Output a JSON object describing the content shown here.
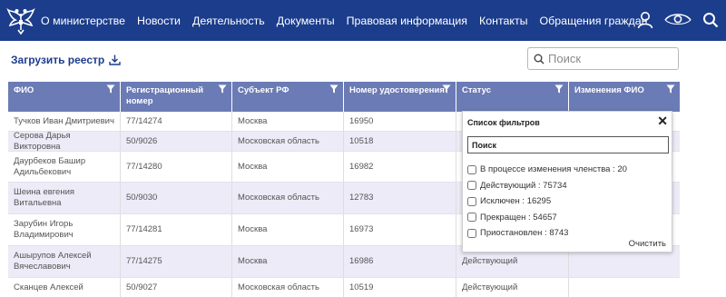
{
  "colors": {
    "header_bg": "#1c3d8c",
    "table_header_bg": "#6b7bb5",
    "row_alt_bg": "#ecebf7"
  },
  "nav": {
    "items": [
      "О министерстве",
      "Новости",
      "Деятельность",
      "Документы",
      "Правовая информация",
      "Контакты",
      "Обращения граждан"
    ],
    "icons": [
      "user-icon",
      "eye-icon",
      "search-icon"
    ]
  },
  "logo": {
    "icon": "double-headed-eagle-emblem"
  },
  "toolbar": {
    "upload_label": "Загрузить реестр",
    "upload_icon": "download-icon",
    "search_placeholder": "Поиск"
  },
  "table": {
    "headers": [
      "ФИО",
      "Регистрационный номер",
      "Субъект РФ",
      "Номер удостоверения",
      "Статус",
      "Изменения ФИО"
    ],
    "rows": [
      [
        "Тучков Иван Дмитриевич",
        "77/14274",
        "Москва",
        "16950",
        "",
        ""
      ],
      [
        "Серова Дарья Викторовна",
        "50/9026",
        "Московская область",
        "10518",
        "",
        ""
      ],
      [
        "Даурбеков Башир Адильбекович",
        "77/14280",
        "Москва",
        "16982",
        "",
        ""
      ],
      [
        "Шеина евгения Витальевна",
        "50/9030",
        "Московская область",
        "12783",
        "",
        ""
      ],
      [
        "Зарубин Игорь Владимирович",
        "77/14281",
        "Москва",
        "16973",
        "",
        ""
      ],
      [
        "Ашырупов Алексей Вячеславович",
        "77/14275",
        "Москва",
        "16986",
        "Действующий",
        ""
      ],
      [
        "Сканцев Алексей",
        "50/9027",
        "Московская область",
        "10519",
        "Действующий",
        ""
      ]
    ]
  },
  "filter_popup": {
    "title": "Список фильтров",
    "search_placeholder": "Поиск",
    "options": [
      "В процессе изменения членства : 20",
      "Действующий : 75734",
      "Исключен : 16295",
      "Прекращен : 54657",
      "Приостановлен : 8743"
    ],
    "clear_label": "Очистить"
  }
}
